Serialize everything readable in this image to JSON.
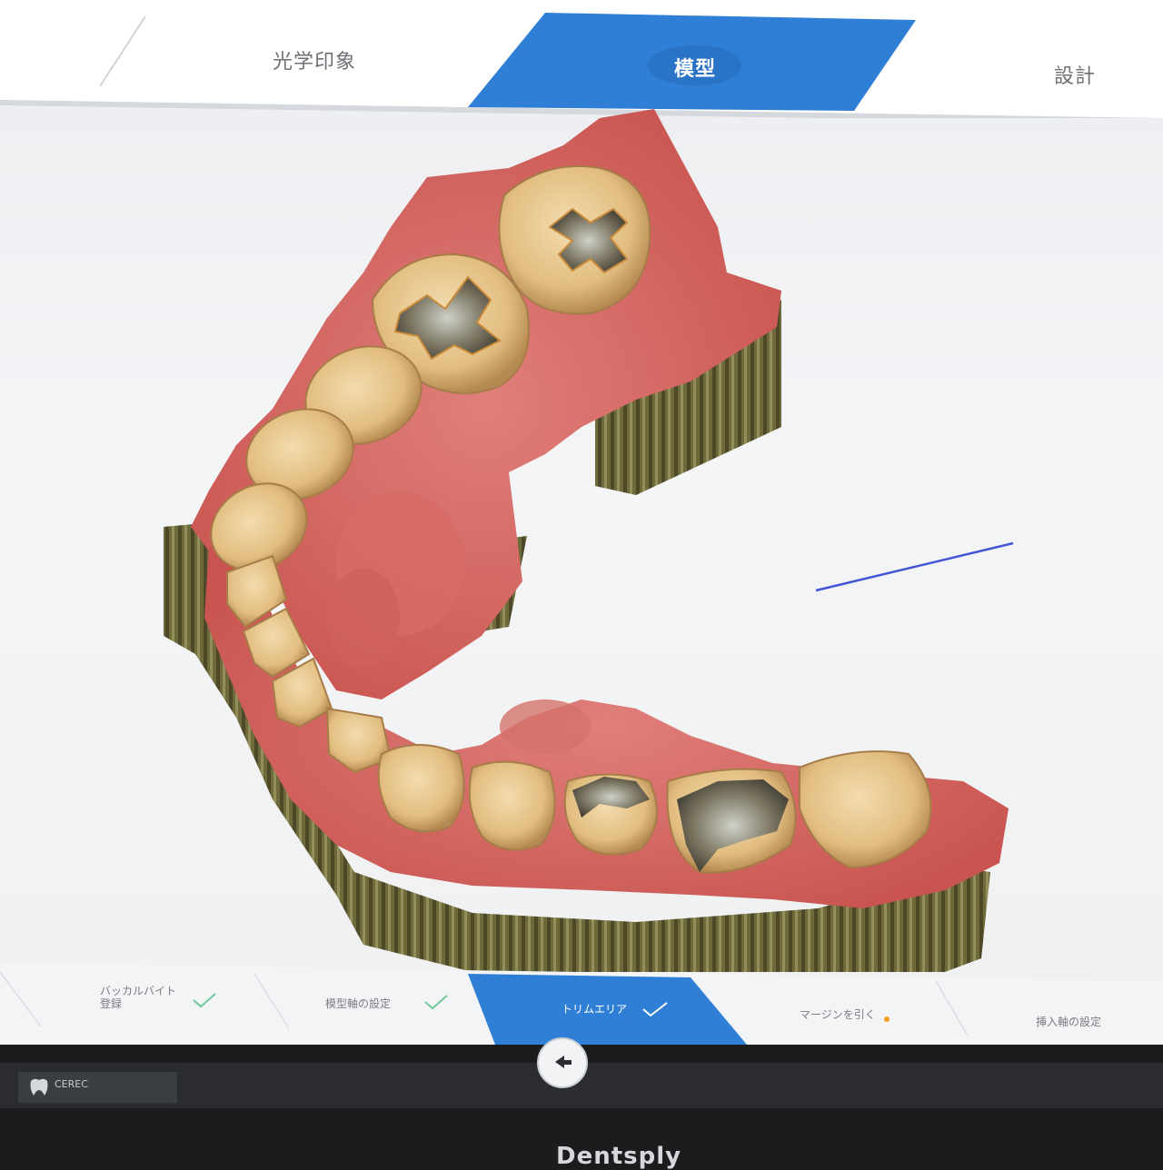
{
  "top_steps": {
    "step1": "光学印象",
    "step2": "模型",
    "step3": "設計"
  },
  "bottom_steps": {
    "buccal_bite_line1": "バッカルバイト",
    "buccal_bite_line2": "登録",
    "model_axis": "模型軸の設定",
    "trim_area": "トリムエリア",
    "margin": "マージンを引く",
    "insertion_axis": "挿入軸の設定"
  },
  "taskbar": {
    "app_label": "CEREC"
  },
  "bezel": {
    "brand": "Dentsply"
  },
  "colors": {
    "accent_blue": "#2f7fd6",
    "check_green": "#6fc79a",
    "margin_dot": "#f0a020",
    "gingiva": "#d9696a",
    "tooth": "#e6c28a",
    "base": "#6f6a3c"
  },
  "icons": {
    "nav_back": "left-arrow-icon",
    "step_done": "checkmark-icon",
    "app": "cerec-tooth-icon"
  }
}
